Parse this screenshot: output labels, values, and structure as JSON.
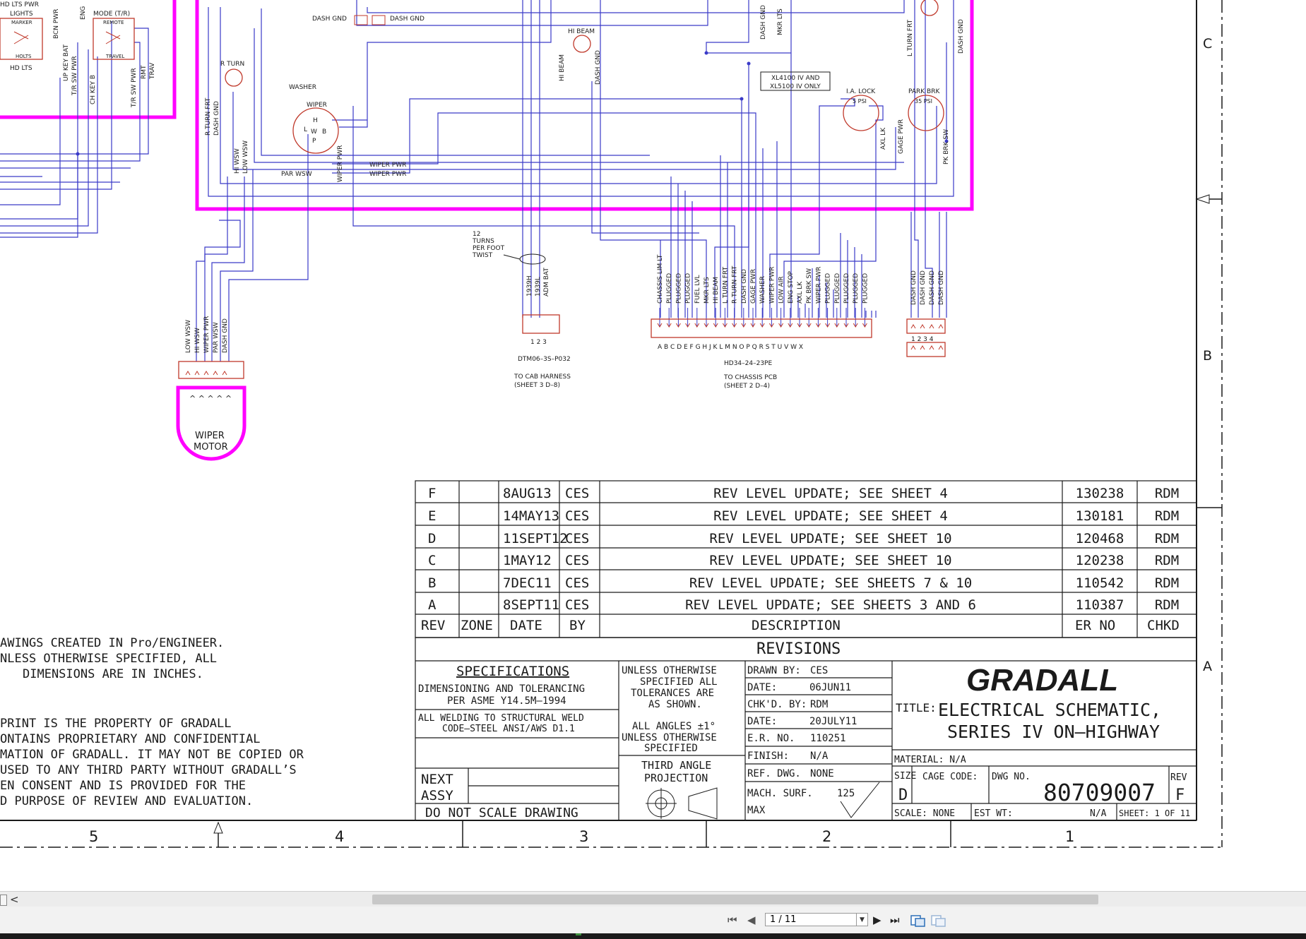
{
  "colors": {
    "wire": "#3a3ac8",
    "harness": "#ff00ff",
    "connector": "#c0392b",
    "ink": "#1a1a1a",
    "grid": "#a0a0a0"
  },
  "connectors": {
    "hd_lts_pwr": "HD LTS PWR",
    "lights": "LIGHTS",
    "marker": "MARKER",
    "holts": "HOLTS",
    "hd_lts": "HD LTS",
    "mode_tr": "MODE (T/R)",
    "remote": "REMOTE",
    "travel": "TRAVEL",
    "bcn_pwr": "BCN PWR",
    "eng": "ENG",
    "up_key_bat": "UP KEY BAT",
    "tr_sw_pwr": "T/R SW PWR",
    "ch_key_b": "CH KEY B",
    "tr_sw_pwr2": "T/R SW PWR",
    "rmt": "RMT",
    "trav": "TRAV",
    "r_turn": "R TURN",
    "r_turn_frt": "R TURN FRT",
    "dash_gnd_side": "DASH GND",
    "washer": "WASHER",
    "wiper": "WIPER",
    "hi_wsw": "HI WSW",
    "low_wsw": "LOW WSW",
    "par_wsw": "PAR WSW",
    "wiper_pwr": "WIPER PWR",
    "wiper_pwr_a": "WIPER PWR",
    "wiper_pwr_b": "WIPER PWR",
    "dash_gnd_a": "DASH GND",
    "dash_gnd_b": "DASH GND",
    "hi_beam": "HI BEAM",
    "hi_beam_v": "HI BEAM",
    "dash_gnd_v": "DASH GND",
    "dash_gnd_top": "DASH GND",
    "mkr_lts_top": "MKR LTS",
    "l_turn_frt_top": "L TURN FRT",
    "dash_gnd_top2": "DASH GND",
    "xl_note_1": "XL4100 IV AND",
    "xl_note_2": "XL5100 IV ONLY",
    "ia_lock": "I.A. LOCK",
    "ia_psi": "5 PSI",
    "axl_lk": "AXL LK",
    "gage_pwr": "GAGE PWR",
    "park_brk": "PARK BRK",
    "park_psi": "35 PSI",
    "pk_brk_sw": "PK BRK SW",
    "twist_1": "12",
    "twist_2": "TURNS",
    "twist_3": "PER FOOT",
    "twist_4": "TWIST",
    "dtm_wires": [
      "1939H",
      "1939L",
      "ADM BAT"
    ],
    "dtm_pins": "1  2  3",
    "dtm_part": "DTM06–3S–P032",
    "dtm_to_1": "TO CAB HARNESS",
    "dtm_to_2": "(SHEET 3 D–8)",
    "hd_wires": [
      "CHASSIS LIM LT",
      "PLUGGED",
      "PLUGGED",
      "PLUGGED",
      "FUEL LVL",
      "MKR LTS",
      "HI BEAM",
      "L TURN FRT",
      "R TURN FRT",
      "DASH GND",
      "GAGE PWR",
      "WASHER",
      "WIPER PWR",
      "LOW AIR",
      "ENG STOP",
      "AXL LK",
      "PK BRK SW",
      "WIPER PWR",
      "PLUGGED",
      "PLUGGED",
      "PLUGGED",
      "PLUGGED",
      "PLUGGED"
    ],
    "hd_pins": "A B C D E F G H J K L M N O P Q R S T U V W X",
    "hd_part": "HD34–24–23PE",
    "hd_to_1": "TO CHASSIS PCB",
    "hd_to_2": "(SHEET 2 D–4)",
    "right_wires": [
      "DASH GND",
      "DASH GND",
      "DASH GND",
      "DASH GND"
    ],
    "right_pins": "1 2 3 4",
    "motor_wires": [
      "LOW WSW",
      "HI WSW",
      "WIPER PWR",
      "PAR WSW",
      "DASH GND"
    ],
    "motor_1": "WIPER",
    "motor_2": "MOTOR"
  },
  "zones": {
    "c": "C",
    "b": "B",
    "a": "A",
    "cols": [
      "5",
      "4",
      "3",
      "2",
      "1"
    ]
  },
  "revisions": {
    "rows": [
      {
        "rev": "F",
        "date": "8AUG13",
        "by": "CES",
        "desc": "REV LEVEL UPDATE; SEE SHEET 4",
        "er": "130238",
        "chkd": "RDM"
      },
      {
        "rev": "E",
        "date": "14MAY13",
        "by": "CES",
        "desc": "REV LEVEL UPDATE; SEE SHEET 4",
        "er": "130181",
        "chkd": "RDM"
      },
      {
        "rev": "D",
        "date": "11SEPT12",
        "by": "CES",
        "desc": "REV LEVEL UPDATE; SEE SHEET 10",
        "er": "120468",
        "chkd": "RDM"
      },
      {
        "rev": "C",
        "date": "1MAY12",
        "by": "CES",
        "desc": "REV LEVEL UPDATE; SEE SHEET 10",
        "er": "120238",
        "chkd": "RDM"
      },
      {
        "rev": "B",
        "date": "7DEC11",
        "by": "CES",
        "desc": "REV LEVEL UPDATE; SEE SHEETS 7 & 10",
        "er": "110542",
        "chkd": "RDM"
      },
      {
        "rev": "A",
        "date": "8SEPT11",
        "by": "CES",
        "desc": "REV LEVEL UPDATE; SEE SHEETS 3 AND 6",
        "er": "110387",
        "chkd": "RDM"
      }
    ],
    "headers": {
      "rev": "REV",
      "zone": "ZONE",
      "date": "DATE",
      "by": "BY",
      "desc": "DESCRIPTION",
      "er": "ER NO",
      "chkd": "CHKD"
    },
    "title": "REVISIONS"
  },
  "notes": {
    "n1": "AWINGS CREATED IN Pro/ENGINEER.",
    "n2": "NLESS OTHERWISE SPECIFIED, ALL",
    "n3": "DIMENSIONS ARE IN INCHES.",
    "p1": "PRINT IS THE PROPERTY OF GRADALL",
    "p2": "ONTAINS PROPRIETARY AND CONFIDENTIAL",
    "p3": "MATION OF GRADALL. IT MAY NOT BE COPIED OR",
    "p4": "USED TO ANY THIRD PARTY WITHOUT GRADALL’S",
    "p5": "EN CONSENT AND IS PROVIDED FOR THE",
    "p6": "D PURPOSE OF REVIEW AND EVALUATION."
  },
  "title_block": {
    "spec_title": "SPECIFICATIONS",
    "spec_1a": "DIMENSIONING AND TOLERANCING",
    "spec_1b": "PER ASME Y14.5M–1994",
    "spec_2a": "ALL WELDING TO STRUCTURAL WELD",
    "spec_2b": "CODE–STEEL ANSI/AWS D1.1",
    "next_1": "NEXT",
    "next_2": "ASSY",
    "no_scale": "DO NOT SCALE DRAWING",
    "tol_1": "UNLESS OTHERWISE",
    "tol_2": "SPECIFIED ALL",
    "tol_3": "TOLERANCES ARE",
    "tol_4": "AS SHOWN.",
    "ang_1": "ALL ANGLES ±1°",
    "ang_2": "UNLESS OTHERWISE",
    "ang_3": "SPECIFIED",
    "proj_1": "THIRD ANGLE",
    "proj_2": "PROJECTION",
    "drawn_by_label": "DRAWN BY:",
    "drawn_by": "CES",
    "date_label": "DATE:",
    "date": "06JUN11",
    "chkd_by_label": "CHK'D. BY:",
    "chkd_by": "RDM",
    "date2_label": "DATE:",
    "date2": "20JULY11",
    "er_label": "E.R. NO.",
    "er": "110251",
    "finish_label": "FINISH:",
    "finish": "N/A",
    "ref_label": "REF. DWG.",
    "ref": "NONE",
    "mach_label": "MACH. SURF.",
    "mach_value": "125",
    "mach_max": "MAX",
    "company": "GRADALL",
    "title_label": "TITLE:",
    "title_1": "ELECTRICAL SCHEMATIC,",
    "title_2": "SERIES IV ON–HIGHWAY",
    "material": "MATERIAL: N/A",
    "size_label": "SIZE",
    "size": "D",
    "cage_label": "CAGE CODE:",
    "dwg_label": "DWG NO.",
    "dwg_no": "80709007",
    "rev_label": "REV",
    "rev": "F",
    "scale": "SCALE:  NONE",
    "est_wt": "EST WT:",
    "est_wt_val": "N/A",
    "sheet": "SHEET: 1 OF 11"
  },
  "viewer": {
    "scroll_left": "<",
    "page_value": "1 / 11",
    "first_page": "⏮",
    "prev_page": "◀",
    "next_page": "▶",
    "last_page": "⏭"
  }
}
